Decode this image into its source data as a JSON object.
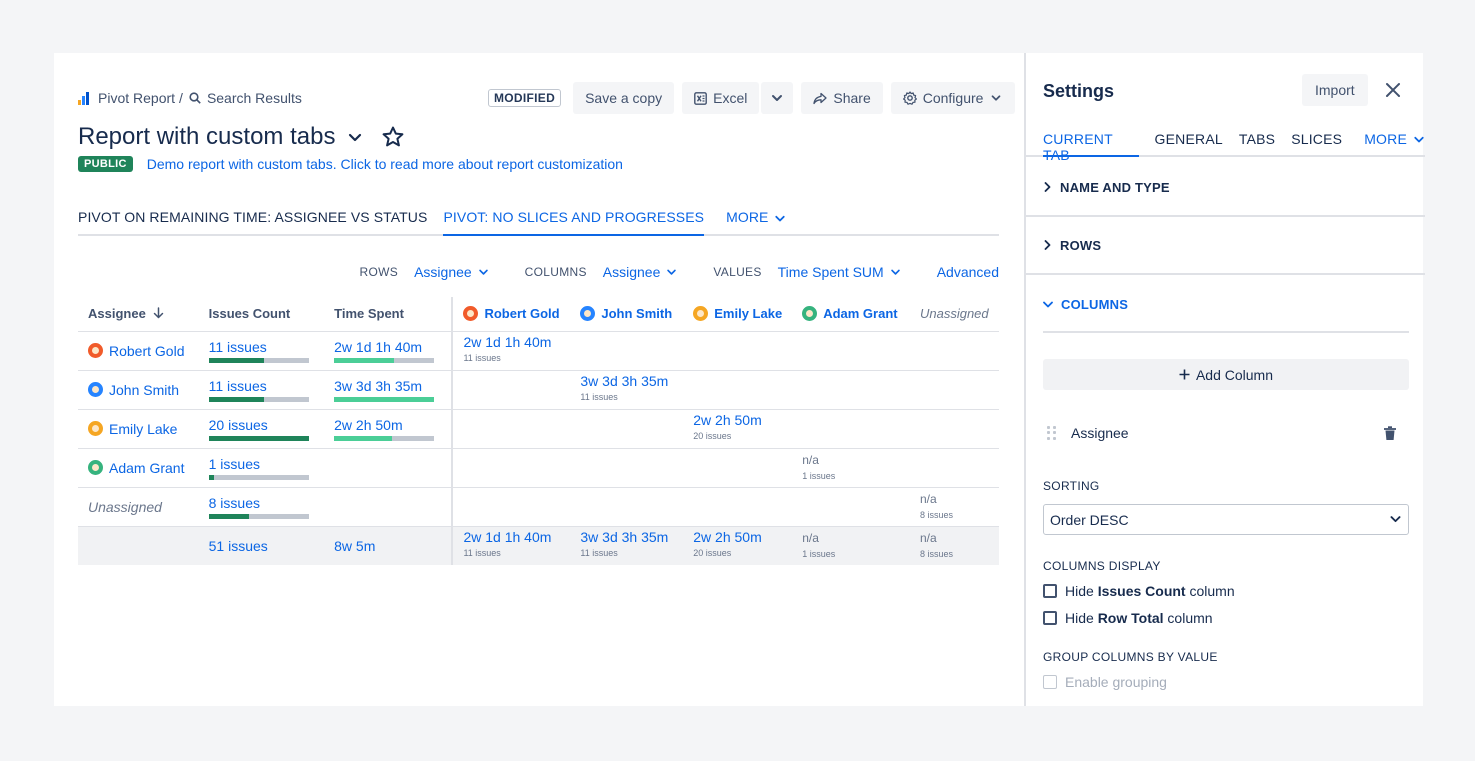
{
  "breadcrumb": {
    "root": "Pivot Report",
    "separator": "/",
    "current": "Search Results"
  },
  "toolbar": {
    "modified_badge": "MODIFIED",
    "save_copy": "Save a copy",
    "excel": "Excel",
    "share": "Share",
    "configure": "Configure"
  },
  "report": {
    "title": "Report with custom tabs",
    "visibility_badge": "PUBLIC",
    "description": "Demo report with custom tabs. Click to read more about report customization"
  },
  "tabs": [
    {
      "label": "PIVOT ON REMAINING TIME: ASSIGNEE VS STATUS",
      "active": false
    },
    {
      "label": "PIVOT: NO SLICES AND PROGRESSES",
      "active": true
    },
    {
      "label": "MORE",
      "active": false
    }
  ],
  "config": {
    "rows_label": "ROWS",
    "rows_value": "Assignee",
    "columns_label": "COLUMNS",
    "columns_value": "Assignee",
    "values_label": "VALUES",
    "values_value": "Time Spent SUM",
    "advanced": "Advanced"
  },
  "table": {
    "headers": {
      "assignee": "Assignee",
      "issues_count": "Issues Count",
      "time_spent": "Time Spent",
      "cols": [
        "Robert Gold",
        "John Smith",
        "Emily Lake",
        "Adam Grant",
        "Unassigned"
      ]
    },
    "rows": [
      {
        "name": "Robert Gold",
        "issues": "11 issues",
        "issues_progress": 0.55,
        "time": "2w 1d 1h 40m",
        "time_progress": 0.6,
        "cell_value": "2w 1d 1h 40m",
        "cell_count": "11 issues"
      },
      {
        "name": "John Smith",
        "issues": "11 issues",
        "issues_progress": 0.55,
        "time": "3w 3d 3h 35m",
        "time_progress": 1.0,
        "cell_value": "3w 3d 3h 35m",
        "cell_count": "11 issues"
      },
      {
        "name": "Emily Lake",
        "issues": "20 issues",
        "issues_progress": 1.0,
        "time": "2w 2h 50m",
        "time_progress": 0.58,
        "cell_value": "2w 2h 50m",
        "cell_count": "20 issues"
      },
      {
        "name": "Adam Grant",
        "issues": "1 issues",
        "issues_progress": 0.05,
        "time": "",
        "cell_value": "n/a",
        "cell_count": "1 issues"
      },
      {
        "name": "Unassigned",
        "issues": "8 issues",
        "issues_progress": 0.4,
        "time": "",
        "cell_value": "n/a",
        "cell_count": "8 issues"
      }
    ],
    "total": {
      "issues": "51 issues",
      "time": "8w 5m",
      "cells": [
        {
          "value": "2w 1d 1h 40m",
          "count": "11 issues"
        },
        {
          "value": "3w 3d 3h 35m",
          "count": "11 issues"
        },
        {
          "value": "2w 2h 50m",
          "count": "20 issues"
        },
        {
          "value": "n/a",
          "count": "1 issues"
        },
        {
          "value": "n/a",
          "count": "8 issues"
        }
      ]
    }
  },
  "settings": {
    "title": "Settings",
    "import": "Import",
    "tabs": [
      "CURRENT TAB",
      "GENERAL",
      "TABS",
      "SLICES",
      "MORE"
    ],
    "sections": [
      "NAME AND TYPE",
      "ROWS",
      "COLUMNS"
    ],
    "add_column": "Add Column",
    "column_item": "Assignee",
    "sorting_label": "SORTING",
    "sorting_value": "Order DESC",
    "columns_display_label": "COLUMNS DISPLAY",
    "hide_issues": {
      "prefix": "Hide ",
      "bold": "Issues Count",
      "suffix": " column"
    },
    "hide_total": {
      "prefix": "Hide ",
      "bold": "Row Total",
      "suffix": " column"
    },
    "group_label": "GROUP COLUMNS BY VALUE",
    "enable_grouping": "Enable grouping"
  },
  "colors": {
    "accent": "#0c66e4",
    "public_badge": "#1f845a",
    "progress_dark": "#1f845a",
    "progress_light": "#4bce97",
    "avatars": [
      "#f15b2a",
      "#2684ff",
      "#f5a623",
      "#36b37e"
    ]
  }
}
